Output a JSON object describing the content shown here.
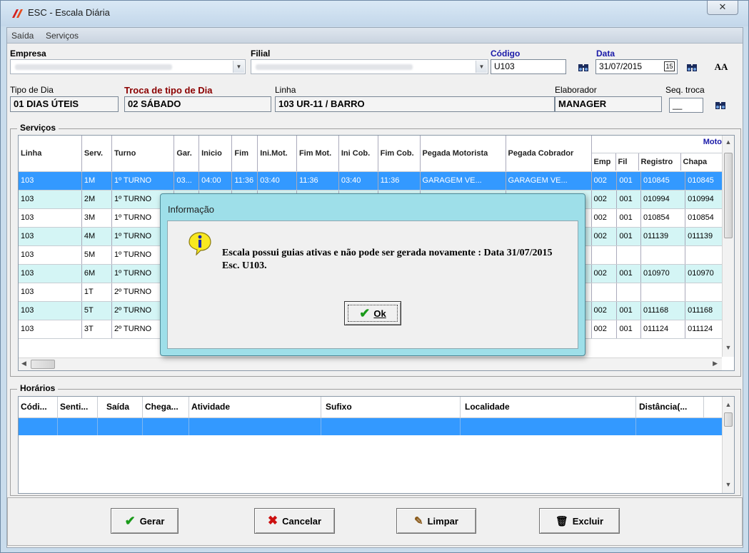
{
  "window": {
    "title": "ESC - Escala Diária",
    "close_label": "✕"
  },
  "menu": [
    "Saída",
    "Serviços"
  ],
  "form": {
    "empresa_label": "Empresa",
    "filial_label": "Filial",
    "codigo_label": "Código",
    "codigo_value": "U103",
    "data_label": "Data",
    "data_value": "31/07/2015",
    "tipo_dia_label": "Tipo de Dia",
    "tipo_dia_value": "01 DIAS ÚTEIS",
    "troca_label": "Troca de tipo de Dia",
    "troca_value": "02 SÁBADO",
    "linha_label": "Linha",
    "linha_value": "103 UR-11 / BARRO",
    "elaborador_label": "Elaborador",
    "elaborador_value": "MANAGER",
    "seq_troca_label": "Seq. troca",
    "seq_troca_value": "__",
    "calendar_label": "15",
    "font_size_label": "AA"
  },
  "servicos": {
    "title": "Serviços",
    "motorista_group": "Moto",
    "columns": [
      "Linha",
      "Serv.",
      "Turno",
      "Gar.",
      "Inicio",
      "Fim",
      "Ini.Mot.",
      "Fim Mot.",
      "Ini Cob.",
      "Fim Cob.",
      "Pegada Motorista",
      "Pegada Cobrador",
      "Emp",
      "Fil",
      "Registro",
      "Chapa"
    ],
    "rows": [
      {
        "style": "sel",
        "cells": [
          "103",
          "1M",
          "1º TURNO",
          "03...",
          "04:00",
          "11:36",
          "03:40",
          "11:36",
          "03:40",
          "11:36",
          "GARAGEM VE...",
          "GARAGEM VE...",
          "002",
          "001",
          "010845",
          "010845"
        ]
      },
      {
        "style": "cyan",
        "cells": [
          "103",
          "2M",
          "1º TURNO",
          "",
          "",
          "",
          "",
          "",
          "",
          "",
          "",
          "",
          "002",
          "001",
          "010994",
          "010994"
        ]
      },
      {
        "style": "white",
        "cells": [
          "103",
          "3M",
          "1º TURNO",
          "",
          "",
          "",
          "",
          "",
          "",
          "",
          "",
          "",
          "002",
          "001",
          "010854",
          "010854"
        ]
      },
      {
        "style": "cyan",
        "cells": [
          "103",
          "4M",
          "1º TURNO",
          "",
          "",
          "",
          "",
          "",
          "",
          "",
          "",
          "",
          "002",
          "001",
          "011139",
          "011139"
        ]
      },
      {
        "style": "white",
        "cells": [
          "103",
          "5M",
          "1º TURNO",
          "",
          "",
          "",
          "",
          "",
          "",
          "",
          "",
          "",
          "",
          "",
          "",
          ""
        ]
      },
      {
        "style": "cyan",
        "cells": [
          "103",
          "6M",
          "1º TURNO",
          "",
          "",
          "",
          "",
          "",
          "",
          "",
          "",
          "",
          "002",
          "001",
          "010970",
          "010970"
        ]
      },
      {
        "style": "white",
        "cells": [
          "103",
          "1T",
          "2º TURNO",
          "",
          "",
          "",
          "",
          "",
          "",
          "",
          "",
          "",
          "",
          "",
          "",
          ""
        ]
      },
      {
        "style": "cyan",
        "cells": [
          "103",
          "5T",
          "2º TURNO",
          "",
          "",
          "",
          "",
          "",
          "",
          "",
          "",
          "",
          "002",
          "001",
          "011168",
          "011168"
        ]
      },
      {
        "style": "white",
        "cells": [
          "103",
          "3T",
          "2º TURNO",
          "",
          "",
          "",
          "",
          "",
          "",
          "",
          "",
          "",
          "002",
          "001",
          "011124",
          "011124"
        ]
      }
    ]
  },
  "horarios": {
    "title": "Horários",
    "columns": [
      "Códi...",
      "Senti...",
      "Saída",
      "Chega...",
      "Atividade",
      "Sufixo",
      "Localidade",
      "Distância(..."
    ]
  },
  "buttons": {
    "gerar": "Gerar",
    "cancelar": "Cancelar",
    "limpar": "Limpar",
    "excluir": "Excluir"
  },
  "dialog": {
    "title": "Informação",
    "message": "Escala possui guias ativas e não pode ser gerada novamente : Data 31/07/2015 Esc. U103.",
    "ok": "Ok"
  },
  "colors": {
    "selected_row": "#3399ff",
    "alt_row": "#d4f5f5",
    "dialog_frame": "#9edfe9",
    "label_blue": "#1a1aa8",
    "label_darkred": "#8b0000"
  }
}
